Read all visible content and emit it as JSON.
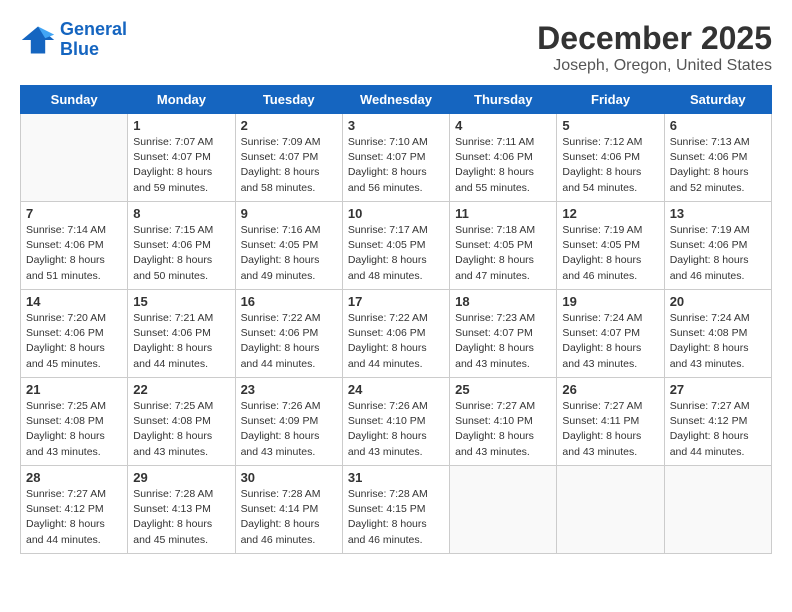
{
  "header": {
    "logo_line1": "General",
    "logo_line2": "Blue",
    "title": "December 2025",
    "subtitle": "Joseph, Oregon, United States"
  },
  "days_of_week": [
    "Sunday",
    "Monday",
    "Tuesday",
    "Wednesday",
    "Thursday",
    "Friday",
    "Saturday"
  ],
  "weeks": [
    [
      {
        "day": "",
        "info": ""
      },
      {
        "day": "1",
        "info": "Sunrise: 7:07 AM\nSunset: 4:07 PM\nDaylight: 8 hours\nand 59 minutes."
      },
      {
        "day": "2",
        "info": "Sunrise: 7:09 AM\nSunset: 4:07 PM\nDaylight: 8 hours\nand 58 minutes."
      },
      {
        "day": "3",
        "info": "Sunrise: 7:10 AM\nSunset: 4:07 PM\nDaylight: 8 hours\nand 56 minutes."
      },
      {
        "day": "4",
        "info": "Sunrise: 7:11 AM\nSunset: 4:06 PM\nDaylight: 8 hours\nand 55 minutes."
      },
      {
        "day": "5",
        "info": "Sunrise: 7:12 AM\nSunset: 4:06 PM\nDaylight: 8 hours\nand 54 minutes."
      },
      {
        "day": "6",
        "info": "Sunrise: 7:13 AM\nSunset: 4:06 PM\nDaylight: 8 hours\nand 52 minutes."
      }
    ],
    [
      {
        "day": "7",
        "info": "Sunrise: 7:14 AM\nSunset: 4:06 PM\nDaylight: 8 hours\nand 51 minutes."
      },
      {
        "day": "8",
        "info": "Sunrise: 7:15 AM\nSunset: 4:06 PM\nDaylight: 8 hours\nand 50 minutes."
      },
      {
        "day": "9",
        "info": "Sunrise: 7:16 AM\nSunset: 4:05 PM\nDaylight: 8 hours\nand 49 minutes."
      },
      {
        "day": "10",
        "info": "Sunrise: 7:17 AM\nSunset: 4:05 PM\nDaylight: 8 hours\nand 48 minutes."
      },
      {
        "day": "11",
        "info": "Sunrise: 7:18 AM\nSunset: 4:05 PM\nDaylight: 8 hours\nand 47 minutes."
      },
      {
        "day": "12",
        "info": "Sunrise: 7:19 AM\nSunset: 4:05 PM\nDaylight: 8 hours\nand 46 minutes."
      },
      {
        "day": "13",
        "info": "Sunrise: 7:19 AM\nSunset: 4:06 PM\nDaylight: 8 hours\nand 46 minutes."
      }
    ],
    [
      {
        "day": "14",
        "info": "Sunrise: 7:20 AM\nSunset: 4:06 PM\nDaylight: 8 hours\nand 45 minutes."
      },
      {
        "day": "15",
        "info": "Sunrise: 7:21 AM\nSunset: 4:06 PM\nDaylight: 8 hours\nand 44 minutes."
      },
      {
        "day": "16",
        "info": "Sunrise: 7:22 AM\nSunset: 4:06 PM\nDaylight: 8 hours\nand 44 minutes."
      },
      {
        "day": "17",
        "info": "Sunrise: 7:22 AM\nSunset: 4:06 PM\nDaylight: 8 hours\nand 44 minutes."
      },
      {
        "day": "18",
        "info": "Sunrise: 7:23 AM\nSunset: 4:07 PM\nDaylight: 8 hours\nand 43 minutes."
      },
      {
        "day": "19",
        "info": "Sunrise: 7:24 AM\nSunset: 4:07 PM\nDaylight: 8 hours\nand 43 minutes."
      },
      {
        "day": "20",
        "info": "Sunrise: 7:24 AM\nSunset: 4:08 PM\nDaylight: 8 hours\nand 43 minutes."
      }
    ],
    [
      {
        "day": "21",
        "info": "Sunrise: 7:25 AM\nSunset: 4:08 PM\nDaylight: 8 hours\nand 43 minutes."
      },
      {
        "day": "22",
        "info": "Sunrise: 7:25 AM\nSunset: 4:08 PM\nDaylight: 8 hours\nand 43 minutes."
      },
      {
        "day": "23",
        "info": "Sunrise: 7:26 AM\nSunset: 4:09 PM\nDaylight: 8 hours\nand 43 minutes."
      },
      {
        "day": "24",
        "info": "Sunrise: 7:26 AM\nSunset: 4:10 PM\nDaylight: 8 hours\nand 43 minutes."
      },
      {
        "day": "25",
        "info": "Sunrise: 7:27 AM\nSunset: 4:10 PM\nDaylight: 8 hours\nand 43 minutes."
      },
      {
        "day": "26",
        "info": "Sunrise: 7:27 AM\nSunset: 4:11 PM\nDaylight: 8 hours\nand 43 minutes."
      },
      {
        "day": "27",
        "info": "Sunrise: 7:27 AM\nSunset: 4:12 PM\nDaylight: 8 hours\nand 44 minutes."
      }
    ],
    [
      {
        "day": "28",
        "info": "Sunrise: 7:27 AM\nSunset: 4:12 PM\nDaylight: 8 hours\nand 44 minutes."
      },
      {
        "day": "29",
        "info": "Sunrise: 7:28 AM\nSunset: 4:13 PM\nDaylight: 8 hours\nand 45 minutes."
      },
      {
        "day": "30",
        "info": "Sunrise: 7:28 AM\nSunset: 4:14 PM\nDaylight: 8 hours\nand 46 minutes."
      },
      {
        "day": "31",
        "info": "Sunrise: 7:28 AM\nSunset: 4:15 PM\nDaylight: 8 hours\nand 46 minutes."
      },
      {
        "day": "",
        "info": ""
      },
      {
        "day": "",
        "info": ""
      },
      {
        "day": "",
        "info": ""
      }
    ]
  ]
}
